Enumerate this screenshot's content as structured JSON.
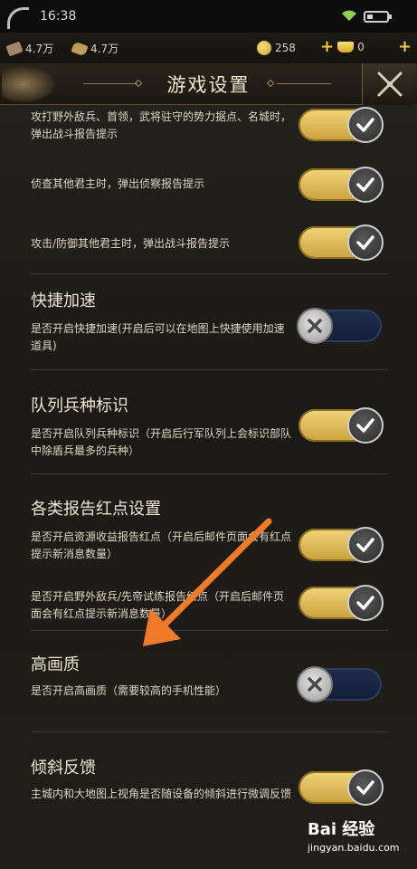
{
  "status": {
    "time": "16:38"
  },
  "resources": {
    "wood": "4.7万",
    "food": "4.7万",
    "coin": "258",
    "ingot": "0"
  },
  "header": {
    "title": "游戏设置"
  },
  "sections": [
    {
      "title": "",
      "items": [
        {
          "desc": "攻打野外敌兵、首领，武将驻守的势力据点、名城时，弹出战斗报告提示",
          "on": true
        },
        {
          "desc": "侦查其他君主时，弹出侦察报告提示",
          "on": true
        },
        {
          "desc": "攻击/防御其他君主时，弹出战斗报告提示",
          "on": true
        }
      ]
    },
    {
      "title": "快捷加速",
      "items": [
        {
          "desc": "是否开启快捷加速(开启后可以在地图上快捷使用加速道具)",
          "on": false
        }
      ]
    },
    {
      "title": "队列兵种标识",
      "items": [
        {
          "desc": "是否开启队列兵种标识（开启后行军队列上会标识部队中除盾兵最多的兵种）",
          "on": true
        }
      ]
    },
    {
      "title": "各类报告红点设置",
      "items": [
        {
          "desc": "是否开启资源收益报告红点（开启后邮件页面会有红点提示新消息数量）",
          "on": true
        },
        {
          "desc": "是否开启野外敌兵/先帝试练报告红点（开启后邮件页面会有红点提示新消息数量）",
          "on": true
        }
      ]
    },
    {
      "title": "高画质",
      "items": [
        {
          "desc": "是否开启高画质（需要较高的手机性能）",
          "on": false
        }
      ]
    },
    {
      "title": "倾斜反馈",
      "items": [
        {
          "desc": "主城内和大地图上视角是否随设备的倾斜进行微调反馈",
          "on": true
        }
      ]
    }
  ],
  "watermark": {
    "logo": "Bai 经验",
    "url": "jingyan.baidu.com"
  },
  "colors": {
    "toggle_on": "#e8c35a",
    "toggle_off": "#1b2743",
    "arrow": "#f07a28"
  }
}
